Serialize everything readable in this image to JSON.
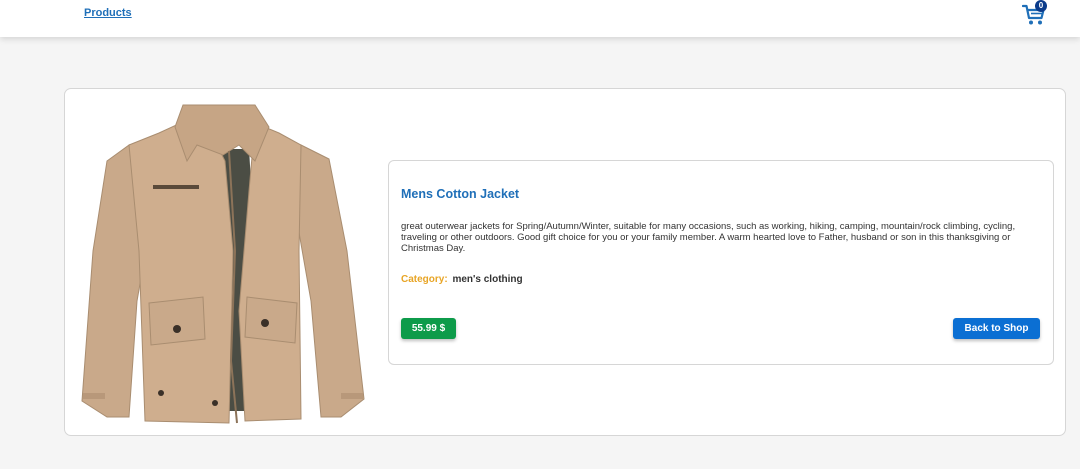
{
  "nav": {
    "products_link": "Products",
    "cart_count": "0",
    "cart_icon": "shopping-cart-icon"
  },
  "product": {
    "title": "Mens Cotton Jacket",
    "description": "great outerwear jackets for Spring/Autumn/Winter, suitable for many occasions, such as working, hiking, camping, mountain/rock climbing, cycling, traveling or other outdoors. Good gift choice for you or your family member. A warm hearted love to Father, husband or son in this thanksgiving or Christmas Day.",
    "category_label": "Category:",
    "category_value": "men's clothing",
    "price": "55.99 $",
    "back_button": "Back to Shop"
  },
  "colors": {
    "link": "#1f6fb8",
    "category_label": "#e8a526",
    "price_badge": "#0d9b4a",
    "button": "#0b6fd3",
    "cart_badge": "#0b3b8a",
    "jacket": "#c9a98a"
  }
}
